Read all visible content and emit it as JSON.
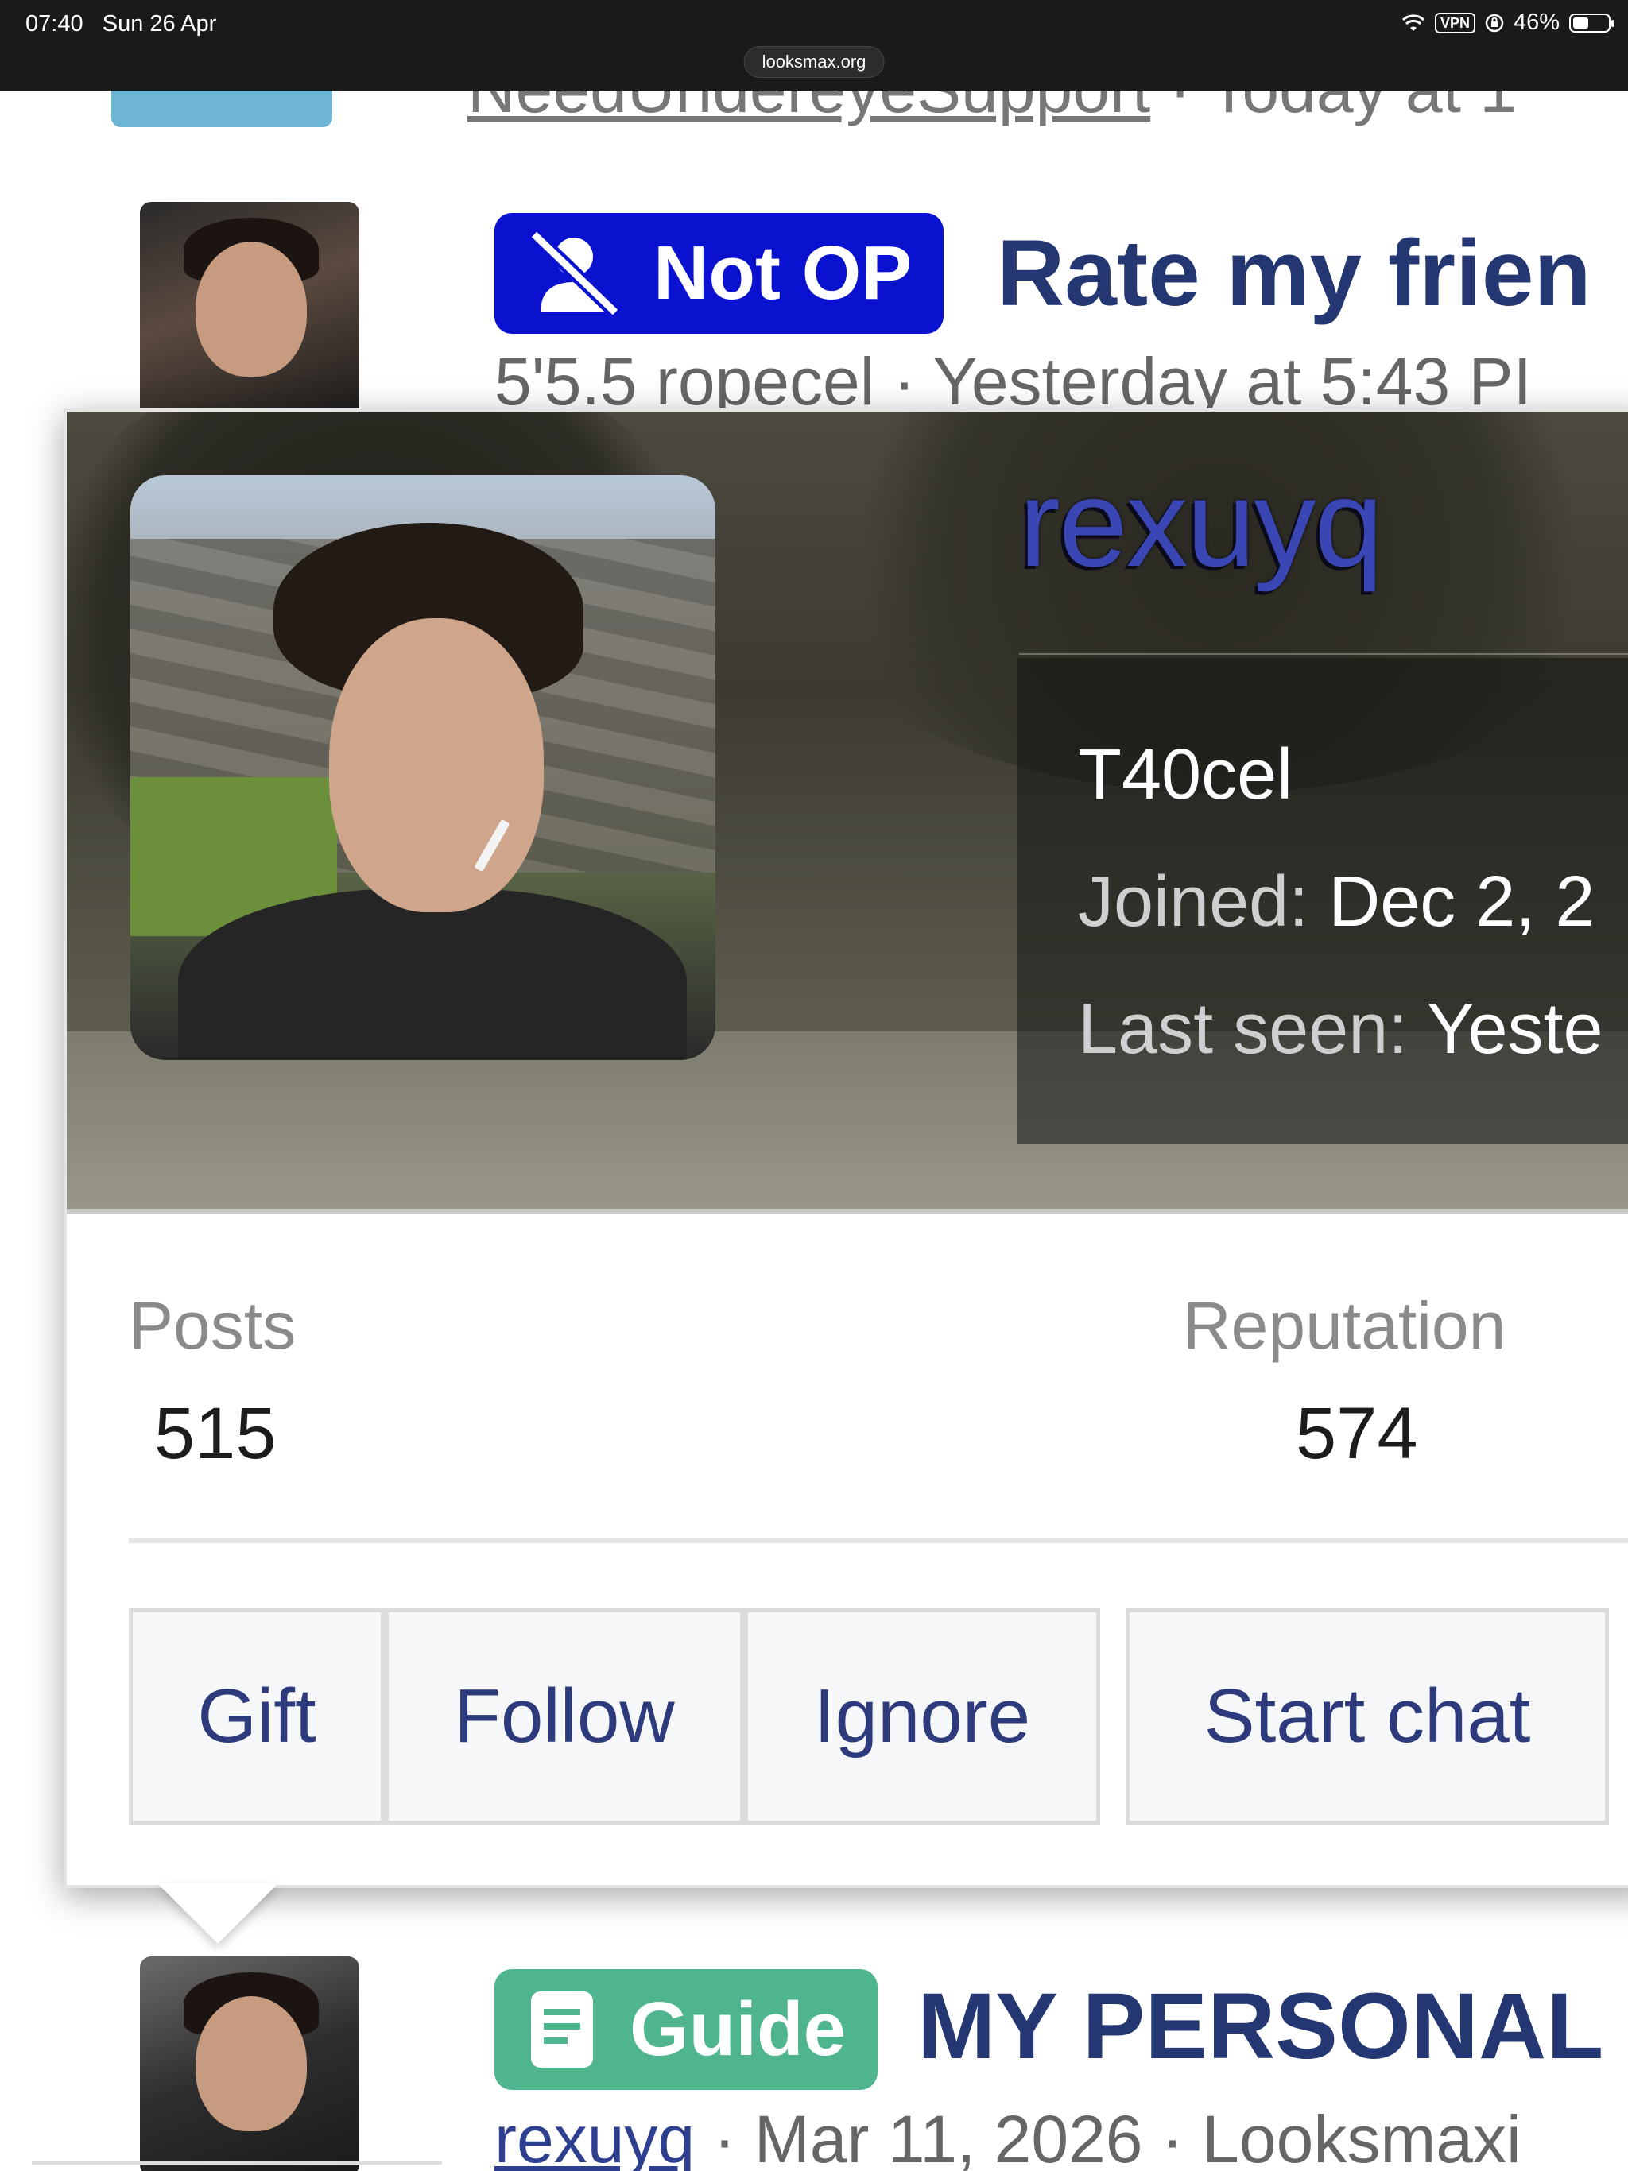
{
  "status_bar": {
    "time": "07:40",
    "date": "Sun 26 Apr",
    "vpn": "VPN",
    "battery": "46%",
    "url": "looksmax.org"
  },
  "list": {
    "row0": {
      "author": "NeedUndereyeSupport",
      "meta_suffix": " · Today at 1"
    },
    "row1": {
      "prefix": "Not OP",
      "title": "Rate my frien",
      "meta": "5'5.5 ropecel · Yesterday at 5:43 PI"
    },
    "row3": {
      "prefix": "Guide",
      "title": "MY PERSONAL",
      "author": "rexuyq",
      "meta_suffix": " · Mar 11, 2026 · Looksmaxi"
    }
  },
  "card": {
    "username": "rexuyq",
    "user_title": "T40cel",
    "joined_label": "Joined:",
    "joined_value": "Dec 2, 2",
    "last_seen_label": "Last seen:",
    "last_seen_value": "Yeste",
    "stats": {
      "posts_label": "Posts",
      "posts_value": "515",
      "reputation_label": "Reputation",
      "reputation_value": "574"
    },
    "buttons": {
      "gift": "Gift",
      "follow": "Follow",
      "ignore": "Ignore",
      "start_chat": "Start chat"
    }
  },
  "colors": {
    "username": "#3a46b4",
    "not_op_prefix": "#0a12cf",
    "guide_prefix": "#4fb58f",
    "title_text": "#243773",
    "button_text": "#2d3a7c"
  }
}
